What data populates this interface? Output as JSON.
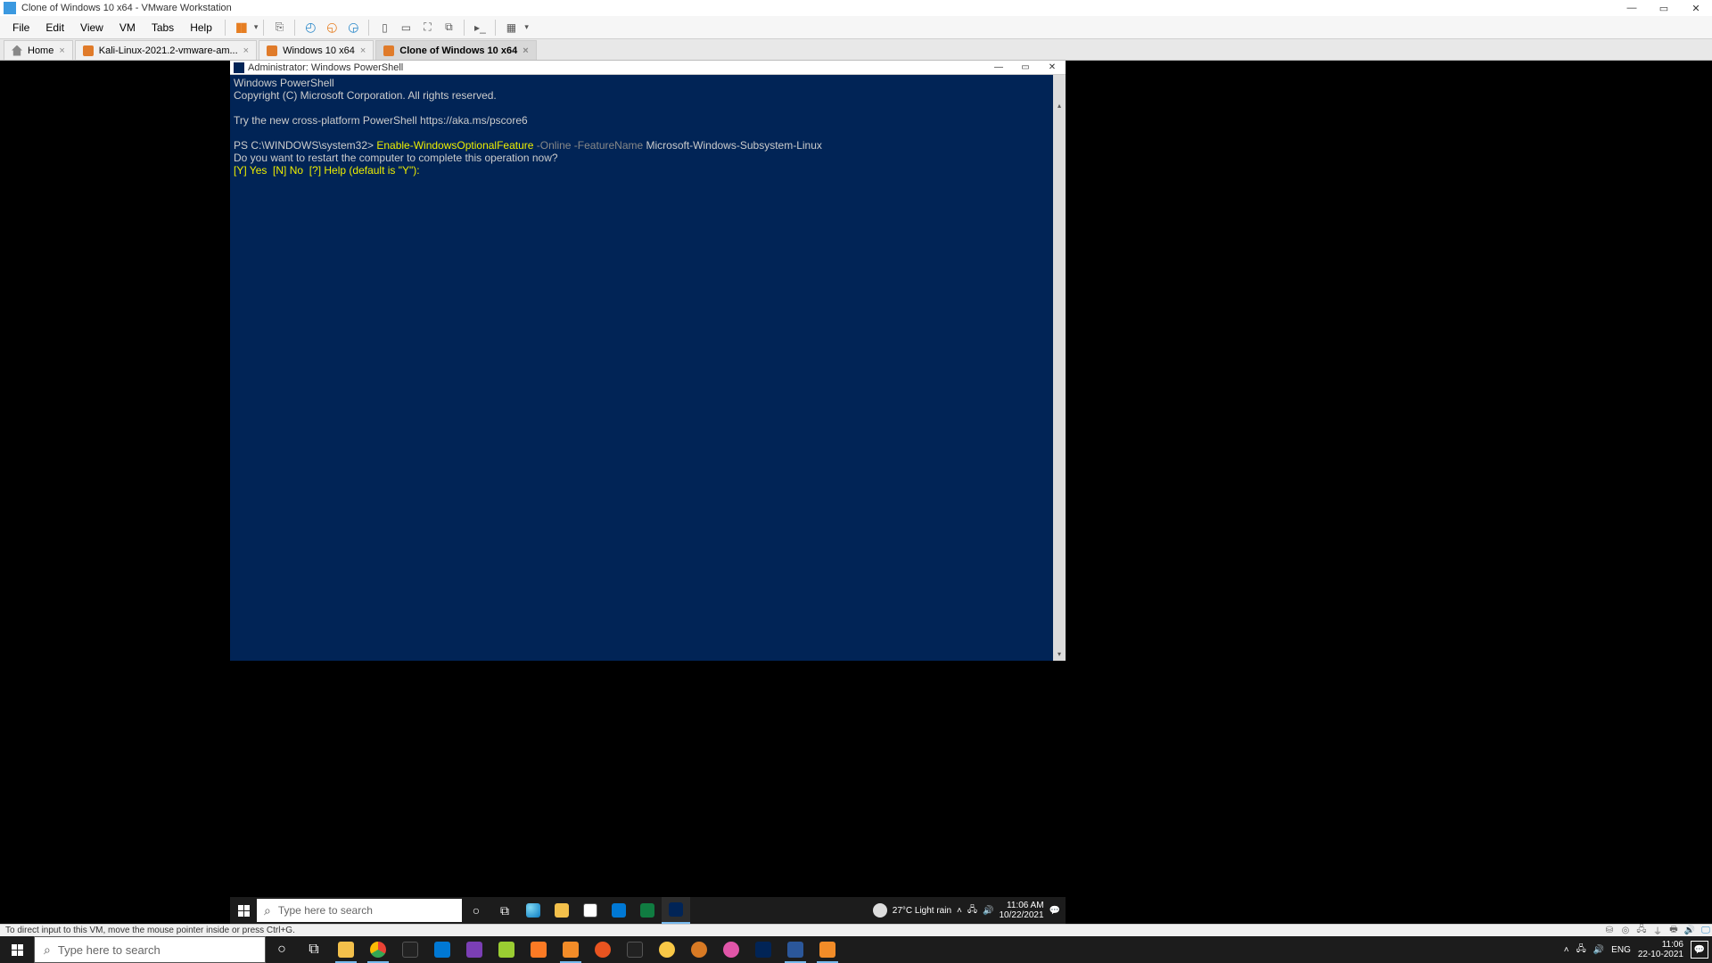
{
  "vmware": {
    "title": "Clone of Windows 10 x64 - VMware Workstation",
    "menu": [
      "File",
      "Edit",
      "View",
      "VM",
      "Tabs",
      "Help"
    ],
    "tabs": [
      {
        "label": "Home",
        "active": false
      },
      {
        "label": "Kali-Linux-2021.2-vmware-am...",
        "active": false
      },
      {
        "label": "Windows 10 x64",
        "active": false
      },
      {
        "label": "Clone of Windows 10 x64",
        "active": true
      }
    ],
    "status": "To direct input to this VM, move the mouse pointer inside or press Ctrl+G."
  },
  "powershell": {
    "title": "Administrator: Windows PowerShell",
    "lines": {
      "l1": "Windows PowerShell",
      "l2": "Copyright (C) Microsoft Corporation. All rights reserved.",
      "l3": "Try the new cross-platform PowerShell https://aka.ms/pscore6",
      "prompt": "PS C:\\WINDOWS\\system32> ",
      "cmd1": "Enable-WindowsOptionalFeature",
      "cmd2": " -Online -FeatureName ",
      "cmd3": "Microsoft-Windows-Subsystem-Linux",
      "l5": "Do you want to restart the computer to complete this operation now?",
      "l6": "[Y] Yes  [N] No  [?] Help (default is \"Y\"):"
    }
  },
  "guest_taskbar": {
    "search_placeholder": "Type here to search",
    "weather": "27°C  Light rain",
    "time": "11:06 AM",
    "date": "10/22/2021"
  },
  "host_taskbar": {
    "search_placeholder": "Type here to search",
    "lang": "ENG",
    "time": "11:06",
    "date": "22-10-2021"
  }
}
